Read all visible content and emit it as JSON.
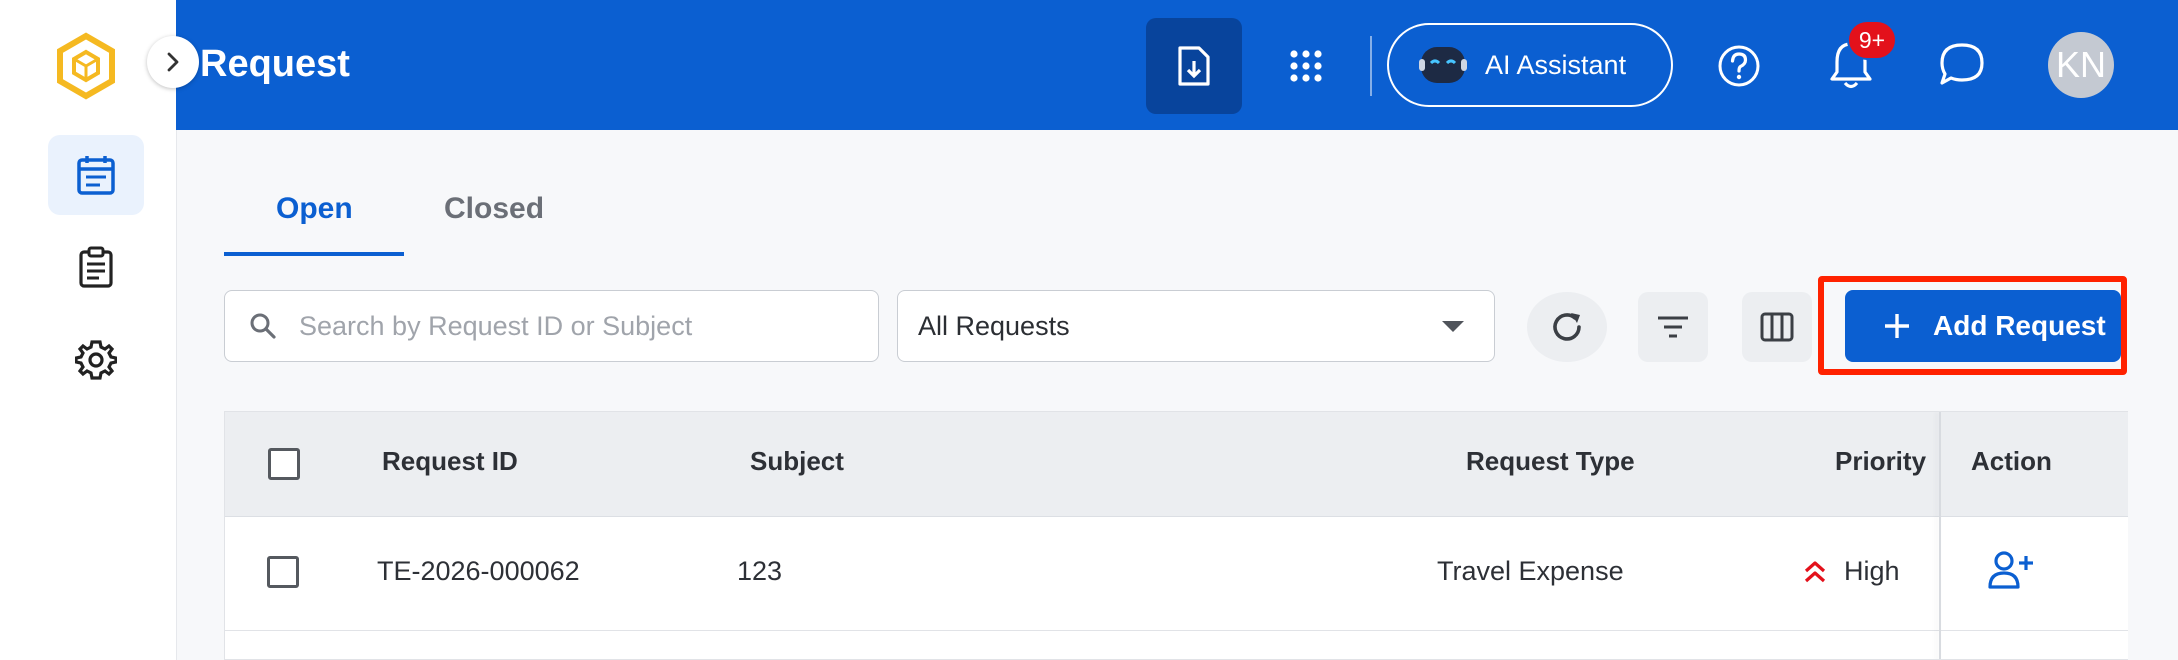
{
  "app": {
    "page_title": "Request",
    "ai_assistant_label": "AI Assistant",
    "notification_badge": "9+",
    "user_initials": "KN",
    "brand_color": "#0b5fd1"
  },
  "sidebar": {
    "items": [
      {
        "name": "requests",
        "icon": "calendar-list-icon",
        "active": true
      },
      {
        "name": "clipboard",
        "icon": "clipboard-list-icon",
        "active": false
      },
      {
        "name": "settings",
        "icon": "gear-icon",
        "active": false
      }
    ]
  },
  "tabs": [
    {
      "label": "Open",
      "active": true
    },
    {
      "label": "Closed",
      "active": false
    }
  ],
  "toolbar": {
    "search_placeholder": "Search by Request ID or Subject",
    "search_value": "",
    "filter_select_value": "All Requests",
    "add_button_label": "Add Request"
  },
  "table": {
    "columns": [
      "Request ID",
      "Subject",
      "Request Type",
      "Priority",
      "Action"
    ],
    "rows": [
      {
        "request_id": "TE-2026-000062",
        "subject": "123",
        "request_type": "Travel Expense",
        "priority": "High",
        "action_icon": "assign-user-icon"
      }
    ]
  },
  "colors": {
    "highlight_outline": "#ff2200",
    "priority_high": "#e3111b"
  }
}
